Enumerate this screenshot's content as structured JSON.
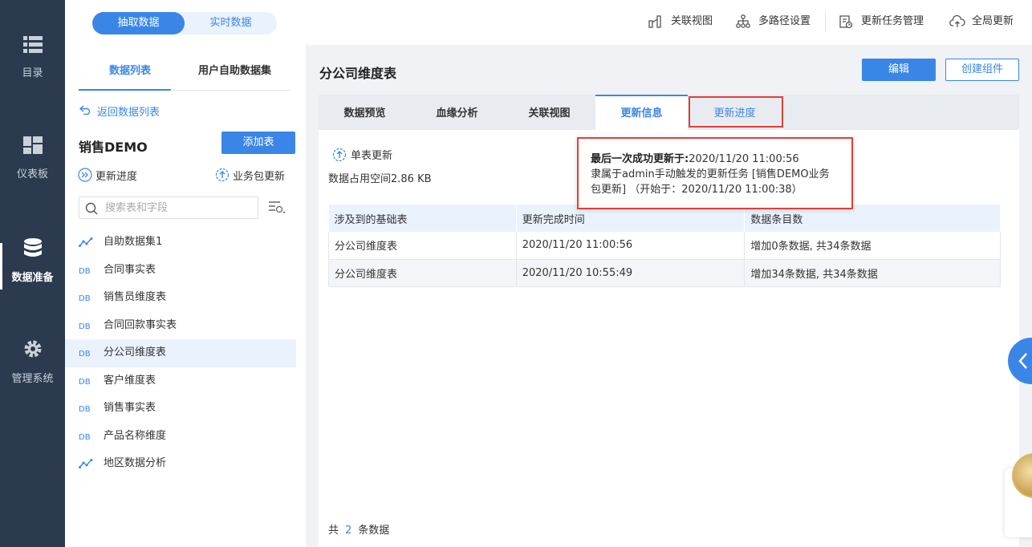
{
  "nav": {
    "items": [
      {
        "label": "目录",
        "icon": "list-icon"
      },
      {
        "label": "仪表板",
        "icon": "dashboard-icon"
      },
      {
        "label": "数据准备",
        "icon": "database-icon",
        "active": true
      },
      {
        "label": "管理系统",
        "icon": "gear-icon"
      }
    ]
  },
  "topbar": {
    "segment": {
      "active": "抽取数据",
      "inactive": "实时数据"
    },
    "actions": [
      {
        "label": "关联视图",
        "icon": "relation-view-icon"
      },
      {
        "label": "多路径设置",
        "icon": "multipath-icon"
      },
      {
        "label": "更新任务管理",
        "icon": "task-manage-icon"
      },
      {
        "label": "全局更新",
        "icon": "cloud-update-icon"
      }
    ]
  },
  "left": {
    "tabs": {
      "active": "数据列表",
      "inactive": "用户自助数据集"
    },
    "back": "返回数据列表",
    "package_title": "销售DEMO",
    "add_table": "添加表",
    "update_progress": "更新进度",
    "package_update": "业务包更新",
    "search_placeholder": "搜索表和字段",
    "tables": [
      {
        "name": "自助数据集1",
        "type": "self-service",
        "icon": "self-dataset-icon"
      },
      {
        "name": "合同事实表",
        "type": "db",
        "icon": "db-table-icon"
      },
      {
        "name": "销售员维度表",
        "type": "db",
        "icon": "db-table-icon"
      },
      {
        "name": "合同回款事实表",
        "type": "db",
        "icon": "db-table-icon"
      },
      {
        "name": "分公司维度表",
        "type": "db",
        "icon": "db-table-icon",
        "selected": true
      },
      {
        "name": "客户维度表",
        "type": "db",
        "icon": "db-table-icon"
      },
      {
        "name": "销售事实表",
        "type": "db",
        "icon": "db-table-icon"
      },
      {
        "name": "产品名称维度",
        "type": "db",
        "icon": "db-table-icon"
      },
      {
        "name": "地区数据分析",
        "type": "self-service",
        "icon": "self-dataset-icon"
      }
    ]
  },
  "main": {
    "title": "分公司维度表",
    "edit": "编辑",
    "create_component": "创建组件",
    "tabs": [
      "数据预览",
      "血缘分析",
      "关联视图",
      "更新信息",
      "更新进度"
    ],
    "active_tab": "更新信息",
    "single_update": "单表更新",
    "space_used": "数据占用空间2.86 KB",
    "table": {
      "headers": [
        "涉及到的基础表",
        "更新完成时间",
        "数据条目数"
      ],
      "rows": [
        [
          "分公司维度表",
          "2020/11/20 11:00:56",
          "增加0条数据, 共34条数据"
        ],
        [
          "分公司维度表",
          "2020/11/20 10:55:49",
          "增加34条数据, 共34条数据"
        ]
      ]
    },
    "total_prefix": "共",
    "total_count": "2",
    "total_suffix": "条数据"
  },
  "tooltip": {
    "label": "最后一次成功更新于:",
    "time": "2020/11/20 11:00:56",
    "line2": "隶属于admin手动触发的更新任务 [销售DEMO业务",
    "line3": "包更新] （开始于：2020/11/20 11:00:38）"
  },
  "colors": {
    "accent": "#3a86e6",
    "nav_bg": "#2b3a4e",
    "highlight": "#e0403a"
  }
}
